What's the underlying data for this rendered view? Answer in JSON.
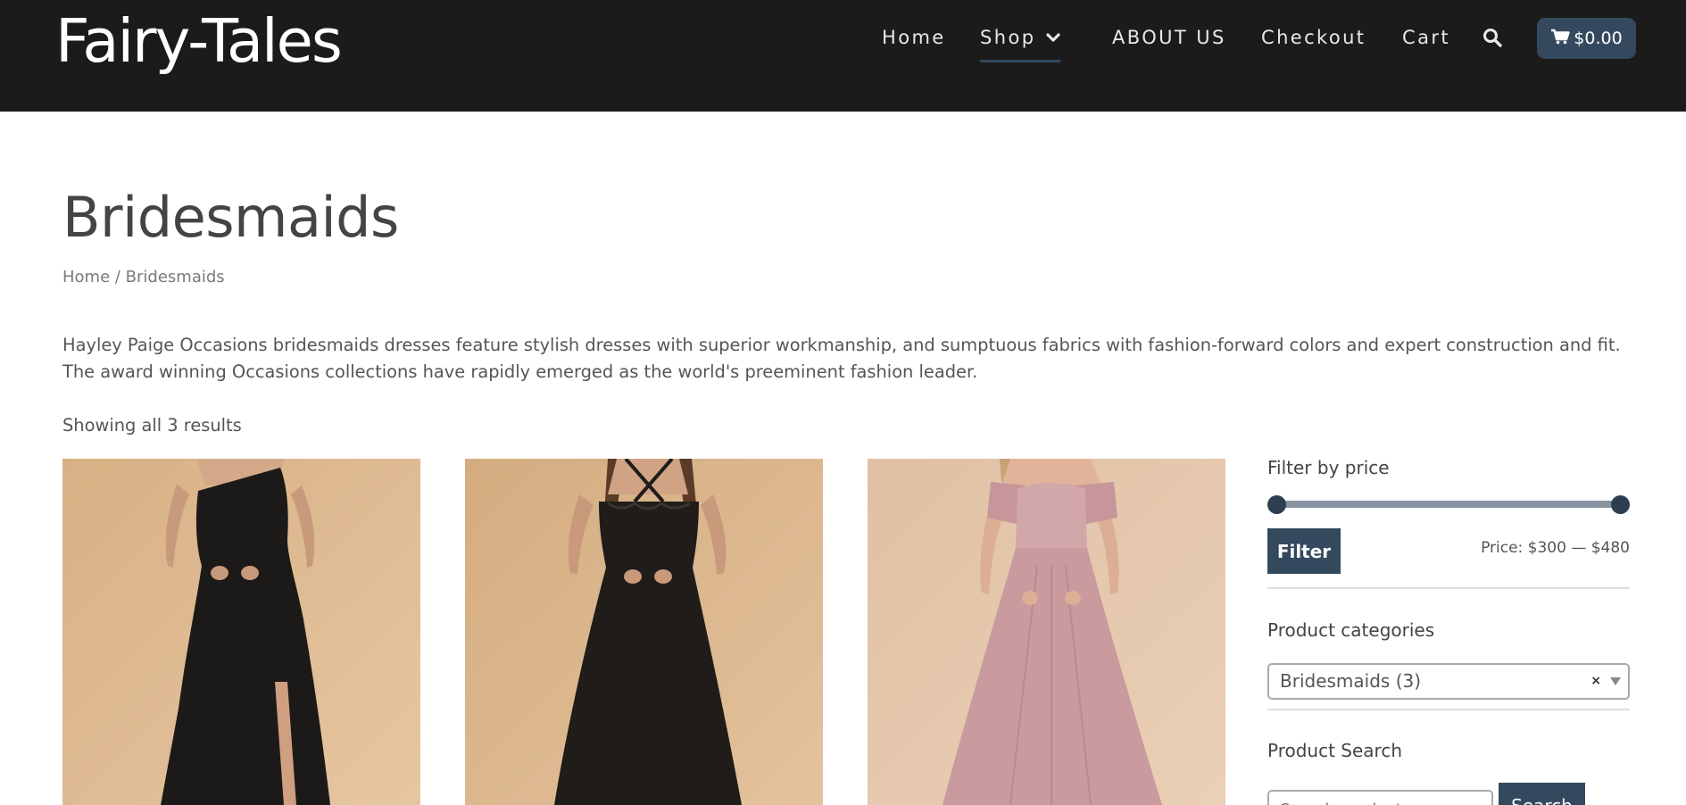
{
  "site": {
    "logo": "Fairy-Tales"
  },
  "nav": {
    "items": [
      {
        "label": "Home",
        "active": false
      },
      {
        "label": "Shop",
        "active": true,
        "has_dropdown": true
      },
      {
        "label": "ABOUT US",
        "active": false
      },
      {
        "label": "Checkout",
        "active": false
      },
      {
        "label": "Cart",
        "active": false
      }
    ],
    "search_icon": "search-icon",
    "cart_total": "$0.00",
    "cart_icon": "shopping-cart-icon"
  },
  "page": {
    "title": "Bridesmaids",
    "breadcrumb": {
      "home": "Home",
      "separator": " / ",
      "current": "Bridesmaids"
    },
    "description": "Hayley Paige Occasions bridesmaids dresses feature stylish dresses with superior workmanship, and sumptuous fabrics with fashion-forward colors and expert construction and fit. The award winning Occasions collections have rapidly emerged as the world's preeminent fashion leader.",
    "result_count": "Showing all 3 results"
  },
  "products": [
    {
      "image": "black one-shoulder gown with slit",
      "dress_color": "#1c1a19",
      "bg_color": "#dcb88f"
    },
    {
      "image": "black halter lace gown",
      "dress_color": "#1f1c1a",
      "bg_color": "#d9b68c"
    },
    {
      "image": "blush pink off-shoulder lace gown",
      "dress_color": "#c99a9e",
      "bg_color": "#e3c5aa"
    }
  ],
  "sidebar": {
    "filter_price": {
      "title": "Filter by price",
      "button": "Filter",
      "price_label": "Price: $300 — $480",
      "min_fraction": 0,
      "max_fraction": 1
    },
    "categories": {
      "title": "Product categories",
      "selected": "Bridesmaids  (3)",
      "clear": "×"
    },
    "search": {
      "title": "Product Search",
      "placeholder": "Search products…",
      "button": "Search"
    }
  },
  "colors": {
    "header_bg": "#1b1b1b",
    "accent": "#34495e",
    "text": "#555555"
  }
}
